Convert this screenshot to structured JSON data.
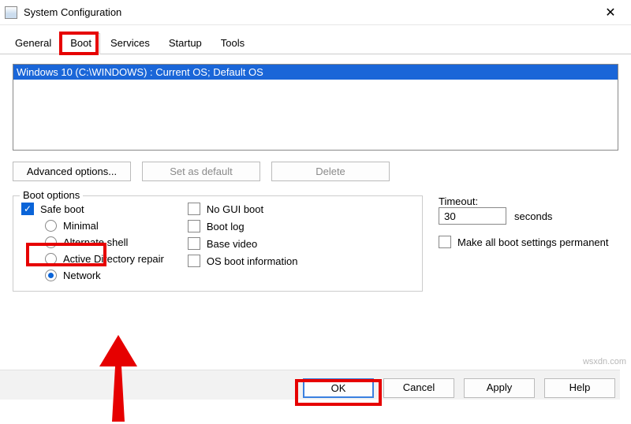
{
  "window": {
    "title": "System Configuration"
  },
  "tabs": {
    "t0": "General",
    "t1": "Boot",
    "t2": "Services",
    "t3": "Startup",
    "t4": "Tools"
  },
  "oslist": {
    "row0": "Windows 10 (C:\\WINDOWS) : Current OS; Default OS"
  },
  "buttons": {
    "advanced": "Advanced options...",
    "set_default": "Set as default",
    "delete": "Delete"
  },
  "boot_options": {
    "legend": "Boot options",
    "safe_boot": "Safe boot",
    "minimal": "Minimal",
    "alt_shell": "Alternate shell",
    "ad_repair": "Active Directory repair",
    "network": "Network",
    "no_gui": "No GUI boot",
    "boot_log": "Boot log",
    "base_video": "Base video",
    "os_info": "OS boot information"
  },
  "timeout": {
    "label": "Timeout:",
    "value": "30",
    "unit": "seconds"
  },
  "permanent": "Make all boot settings permanent",
  "footer": {
    "ok": "OK",
    "cancel": "Cancel",
    "apply": "Apply",
    "help": "Help"
  },
  "watermark": "wsxdn.com"
}
